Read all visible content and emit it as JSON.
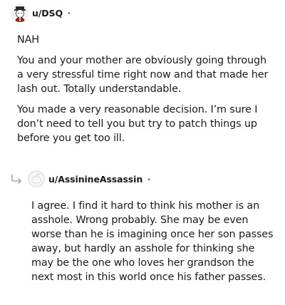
{
  "comments": [
    {
      "username": "u/DSQ",
      "separator": "•",
      "avatar_icon": "user-avatar-icon",
      "paragraphs": [
        "NAH",
        "You and your mother are obviously going through a very stressful time right now and that made her lash out. Totally understandable.",
        "You made a very reasonable decision. I’m sure I don’t need to tell you but try to patch things up before you get too ill."
      ]
    },
    {
      "username": "u/AssinineAssassin",
      "separator": "•",
      "avatar_icon": "default-avatar-icon",
      "reply_icon": "reply-arrow-icon",
      "paragraphs": [
        "I agree. I find it hard to think his mother is an asshole. Wrong probably. She may be even worse than he is imagining once her son passes away, but hardly an asshole for thinking she may be the one who loves her grandson the next most in this world once his father passes."
      ]
    }
  ],
  "colors": {
    "text": "#1a1a1b",
    "meta": "#7c7c7c"
  }
}
